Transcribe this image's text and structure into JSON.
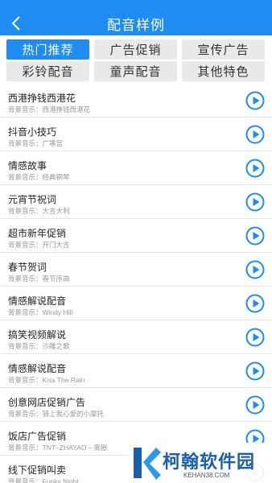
{
  "colors": {
    "accent": "#1e8cf0",
    "tab_inactive": "#e9e9e9",
    "watermark_blue": "#1a5fa8"
  },
  "header": {
    "title": "配音样例",
    "back_icon": "chevron-left-icon"
  },
  "tabs": [
    {
      "label": "热门推荐",
      "active": true
    },
    {
      "label": "广告促销",
      "active": false
    },
    {
      "label": "宣传广告",
      "active": false
    },
    {
      "label": "彩铃配音",
      "active": false
    },
    {
      "label": "童声配音",
      "active": false
    },
    {
      "label": "其他特色",
      "active": false
    }
  ],
  "list": {
    "music_prefix": "背景音乐：",
    "items": [
      {
        "title": "西港挣钱西港花",
        "music": "西港挣钱西港花"
      },
      {
        "title": "抖音小技巧",
        "music": "广寒宫"
      },
      {
        "title": "情感故事",
        "music": "经典钢琴"
      },
      {
        "title": "元宵节祝词",
        "music": "大吉大利"
      },
      {
        "title": "超市新年促销",
        "music": "开门大吉"
      },
      {
        "title": "春节贺词",
        "music": "春节序曲"
      },
      {
        "title": "情感解说配音",
        "music": "Windy Hill"
      },
      {
        "title": "搞笑视频解说",
        "music": "沙雕之歌"
      },
      {
        "title": "情感解说配音",
        "music": "Kiss The Rain"
      },
      {
        "title": "创意网店促销广告",
        "music": "骑上我心爱的小摩托"
      },
      {
        "title": "饭店广告促销",
        "music": "TNT–ZHAYAO – 膨胀"
      },
      {
        "title": "线下促销叫卖",
        "music": "Funky Night"
      }
    ]
  },
  "watermark": {
    "name": "柯翰软件园",
    "url": "KEHAN38.COM"
  }
}
